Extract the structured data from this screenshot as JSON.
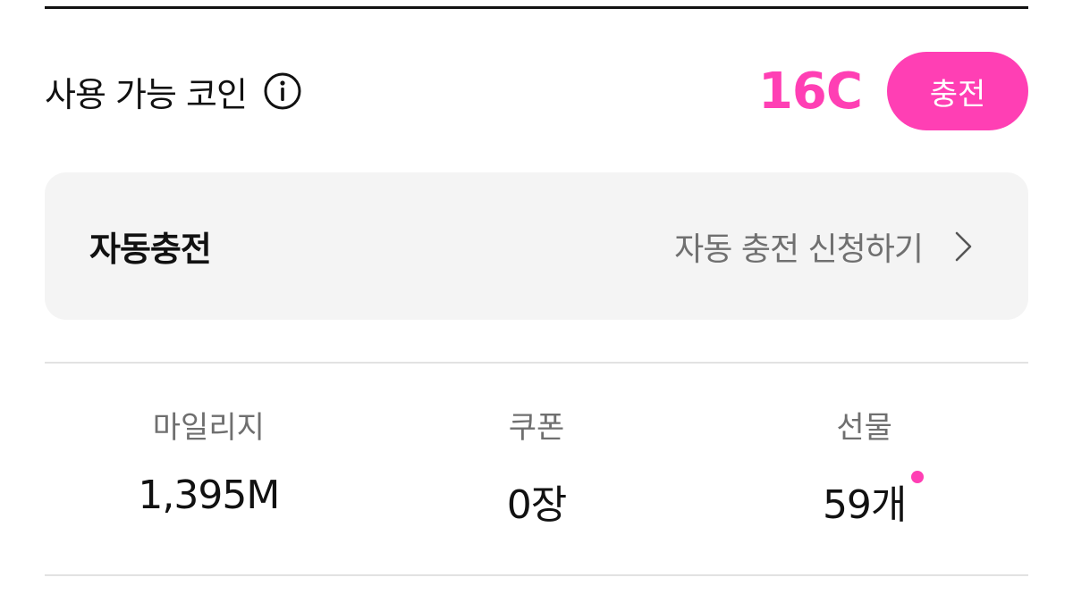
{
  "coin": {
    "label": "사용 가능 코인",
    "amount": "16C",
    "charge_label": "충전"
  },
  "auto_charge": {
    "title": "자동충전",
    "link_label": "자동 충전 신청하기"
  },
  "stats": [
    {
      "label": "마일리지",
      "value": "1,395M",
      "has_new": false
    },
    {
      "label": "쿠폰",
      "value": "0장",
      "has_new": false
    },
    {
      "label": "선물",
      "value": "59개",
      "has_new": true
    }
  ],
  "colors": {
    "accent": "#ff3fb4",
    "card_bg": "#f4f4f4",
    "muted_text": "#707070"
  },
  "icons": {
    "info": "info-circle-icon",
    "chevron": "chevron-right-icon",
    "new_indicator": "new-dot"
  }
}
